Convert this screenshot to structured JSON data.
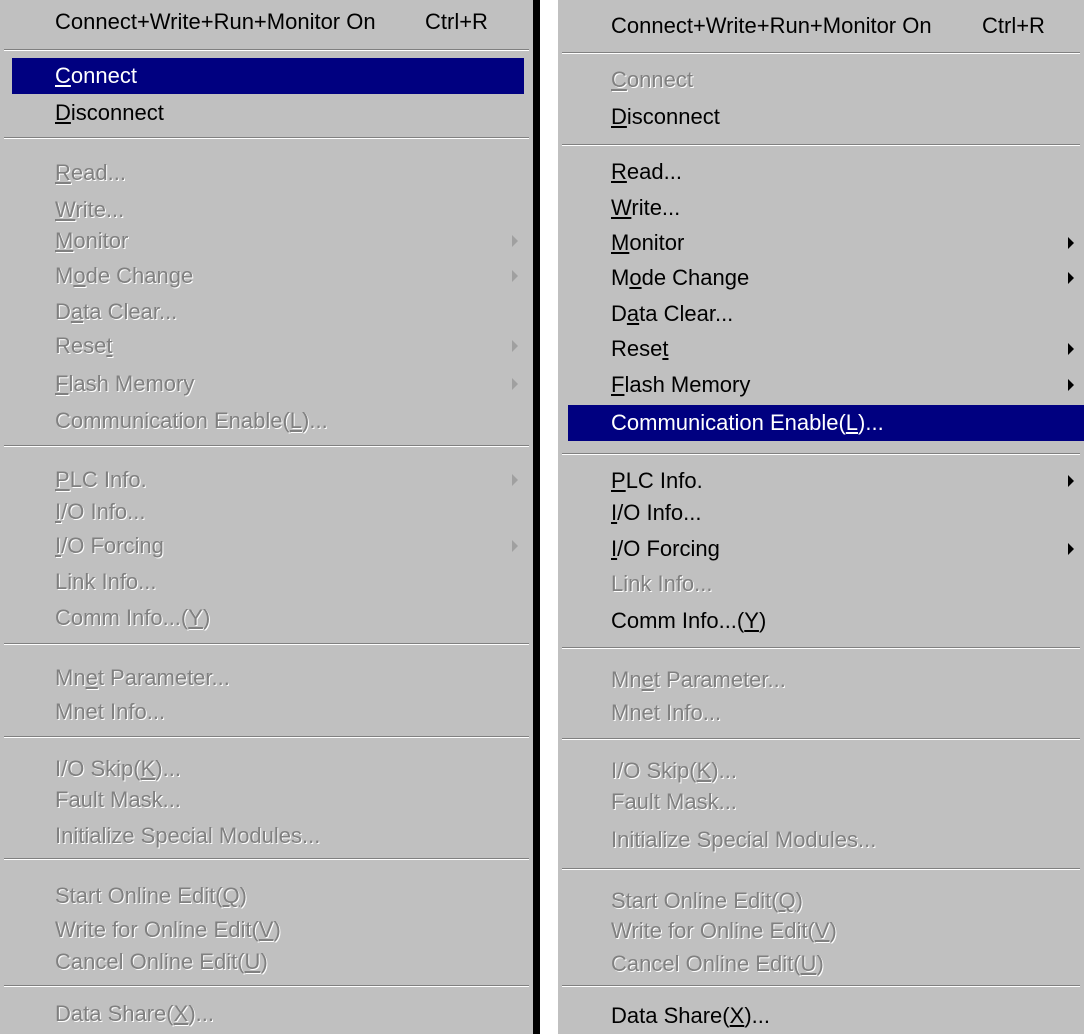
{
  "menus": [
    {
      "items": [
        {
          "label": "Connect+Write+Run+Monitor On",
          "shortcut": "Ctrl+R",
          "enabled": true,
          "highlight": false,
          "submenu": false
        },
        {
          "label": "Connect",
          "mnemonic": 0,
          "enabled": true,
          "highlight": true,
          "submenu": false
        },
        {
          "label": "Disconnect",
          "mnemonic": 0,
          "enabled": true,
          "highlight": false,
          "submenu": false
        },
        {
          "label": "Read...",
          "mnemonic": 0,
          "enabled": false,
          "highlight": false,
          "submenu": false
        },
        {
          "label": "Write...",
          "mnemonic": 0,
          "enabled": false,
          "highlight": false,
          "submenu": false
        },
        {
          "label": "Monitor",
          "mnemonic": 0,
          "enabled": false,
          "highlight": false,
          "submenu": true
        },
        {
          "label": "Mode Change",
          "mnemonic": 1,
          "enabled": false,
          "highlight": false,
          "submenu": true
        },
        {
          "label": "Data Clear...",
          "mnemonic": 1,
          "enabled": false,
          "highlight": false,
          "submenu": false
        },
        {
          "label": "Reset",
          "mnemonic": 4,
          "enabled": false,
          "highlight": false,
          "submenu": true
        },
        {
          "label": "Flash Memory",
          "mnemonic": 0,
          "enabled": false,
          "highlight": false,
          "submenu": true
        },
        {
          "label": "Communication Enable(L)...",
          "mnemonic": 21,
          "enabled": false,
          "highlight": false,
          "submenu": false
        },
        {
          "label": "PLC Info.",
          "mnemonic": 0,
          "enabled": false,
          "highlight": false,
          "submenu": true
        },
        {
          "label": "I/O Info...",
          "mnemonic": 0,
          "enabled": false,
          "highlight": false,
          "submenu": false
        },
        {
          "label": "I/O Forcing",
          "mnemonic": 0,
          "enabled": false,
          "highlight": false,
          "submenu": true
        },
        {
          "label": "Link Info...",
          "enabled": false,
          "highlight": false,
          "submenu": false
        },
        {
          "label": "Comm Info...(Y)",
          "mnemonic": 13,
          "enabled": false,
          "highlight": false,
          "submenu": false
        },
        {
          "label": "Mnet Parameter...",
          "mnemonic": 2,
          "enabled": false,
          "highlight": false,
          "submenu": false
        },
        {
          "label": "Mnet Info...",
          "enabled": false,
          "highlight": false,
          "submenu": false
        },
        {
          "label": "I/O Skip(K)...",
          "mnemonic": 9,
          "enabled": false,
          "highlight": false,
          "submenu": false
        },
        {
          "label": "Fault Mask...",
          "enabled": false,
          "highlight": false,
          "submenu": false
        },
        {
          "label": "Initialize Special Modules...",
          "enabled": false,
          "highlight": false,
          "submenu": false
        },
        {
          "label": "Start Online Edit(Q)",
          "mnemonic": 18,
          "enabled": false,
          "highlight": false,
          "submenu": false
        },
        {
          "label": "Write for Online Edit(V)",
          "mnemonic": 22,
          "enabled": false,
          "highlight": false,
          "submenu": false
        },
        {
          "label": "Cancel Online Edit(U)",
          "mnemonic": 19,
          "enabled": false,
          "highlight": false,
          "submenu": false
        },
        {
          "label": "Data Share(X)...",
          "mnemonic": 11,
          "enabled": false,
          "highlight": false,
          "submenu": false
        }
      ]
    },
    {
      "items": [
        {
          "label": "Connect+Write+Run+Monitor On",
          "shortcut": "Ctrl+R",
          "enabled": true,
          "highlight": false,
          "submenu": false
        },
        {
          "label": "Connect",
          "mnemonic": 0,
          "enabled": false,
          "highlight": false,
          "submenu": false
        },
        {
          "label": "Disconnect",
          "mnemonic": 0,
          "enabled": true,
          "highlight": false,
          "submenu": false
        },
        {
          "label": "Read...",
          "mnemonic": 0,
          "enabled": true,
          "highlight": false,
          "submenu": false
        },
        {
          "label": "Write...",
          "mnemonic": 0,
          "enabled": true,
          "highlight": false,
          "submenu": false
        },
        {
          "label": "Monitor",
          "mnemonic": 0,
          "enabled": true,
          "highlight": false,
          "submenu": true
        },
        {
          "label": "Mode Change",
          "mnemonic": 1,
          "enabled": true,
          "highlight": false,
          "submenu": true
        },
        {
          "label": "Data Clear...",
          "mnemonic": 1,
          "enabled": true,
          "highlight": false,
          "submenu": false
        },
        {
          "label": "Reset",
          "mnemonic": 4,
          "enabled": true,
          "highlight": false,
          "submenu": true
        },
        {
          "label": "Flash Memory",
          "mnemonic": 0,
          "enabled": true,
          "highlight": false,
          "submenu": true
        },
        {
          "label": "Communication Enable(L)...",
          "mnemonic": 21,
          "enabled": true,
          "highlight": true,
          "submenu": false
        },
        {
          "label": "PLC Info.",
          "mnemonic": 0,
          "enabled": true,
          "highlight": false,
          "submenu": true
        },
        {
          "label": "I/O Info...",
          "mnemonic": 0,
          "enabled": true,
          "highlight": false,
          "submenu": false
        },
        {
          "label": "I/O Forcing",
          "mnemonic": 0,
          "enabled": true,
          "highlight": false,
          "submenu": true
        },
        {
          "label": "Link Info...",
          "enabled": false,
          "highlight": false,
          "submenu": false
        },
        {
          "label": "Comm Info...(Y)",
          "mnemonic": 13,
          "enabled": true,
          "highlight": false,
          "submenu": false
        },
        {
          "label": "Mnet Parameter...",
          "mnemonic": 2,
          "enabled": false,
          "highlight": false,
          "submenu": false
        },
        {
          "label": "Mnet Info...",
          "enabled": false,
          "highlight": false,
          "submenu": false
        },
        {
          "label": "I/O Skip(K)...",
          "mnemonic": 9,
          "enabled": false,
          "highlight": false,
          "submenu": false
        },
        {
          "label": "Fault Mask...",
          "enabled": false,
          "highlight": false,
          "submenu": false
        },
        {
          "label": "Initialize Special Modules...",
          "enabled": false,
          "highlight": false,
          "submenu": false
        },
        {
          "label": "Start Online Edit(Q)",
          "mnemonic": 18,
          "enabled": false,
          "highlight": false,
          "submenu": false
        },
        {
          "label": "Write for Online Edit(V)",
          "mnemonic": 22,
          "enabled": false,
          "highlight": false,
          "submenu": false
        },
        {
          "label": "Cancel Online Edit(U)",
          "mnemonic": 19,
          "enabled": false,
          "highlight": false,
          "submenu": false
        },
        {
          "label": "Data Share(X)...",
          "mnemonic": 11,
          "enabled": true,
          "highlight": false,
          "submenu": false
        }
      ]
    }
  ]
}
